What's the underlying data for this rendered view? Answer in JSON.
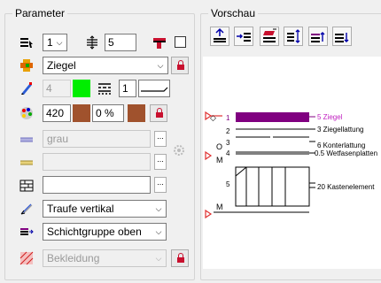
{
  "parameter": {
    "title": "Parameter",
    "layer_count": "1",
    "thickness": "5",
    "material": "Ziegel",
    "pen": "4",
    "line_type": "1",
    "color_value": "420",
    "percent": "0 %",
    "hatch": "grau",
    "text_field": "",
    "direction": "Traufe vertikal",
    "layer_group": "Schichtgruppe oben",
    "cladding": "Bekleidung",
    "colors": {
      "green": "#00ee00",
      "brown": "#a0522d",
      "lock": "#c8102e"
    }
  },
  "preview": {
    "title": "Vorschau",
    "accent": "#800080",
    "labels": {
      "l1": "1",
      "l2": "2",
      "l3": "3",
      "l4": "4",
      "l5": "5",
      "lo": "O",
      "lm": "M",
      "lm2": "M",
      "r1": "5 Ziegel",
      "r2": "3 Ziegellattung",
      "r3": "6 Konterlattung",
      "r4": "0.5 Wetfasenplatten",
      "r5": "20 Kastenelement"
    }
  }
}
